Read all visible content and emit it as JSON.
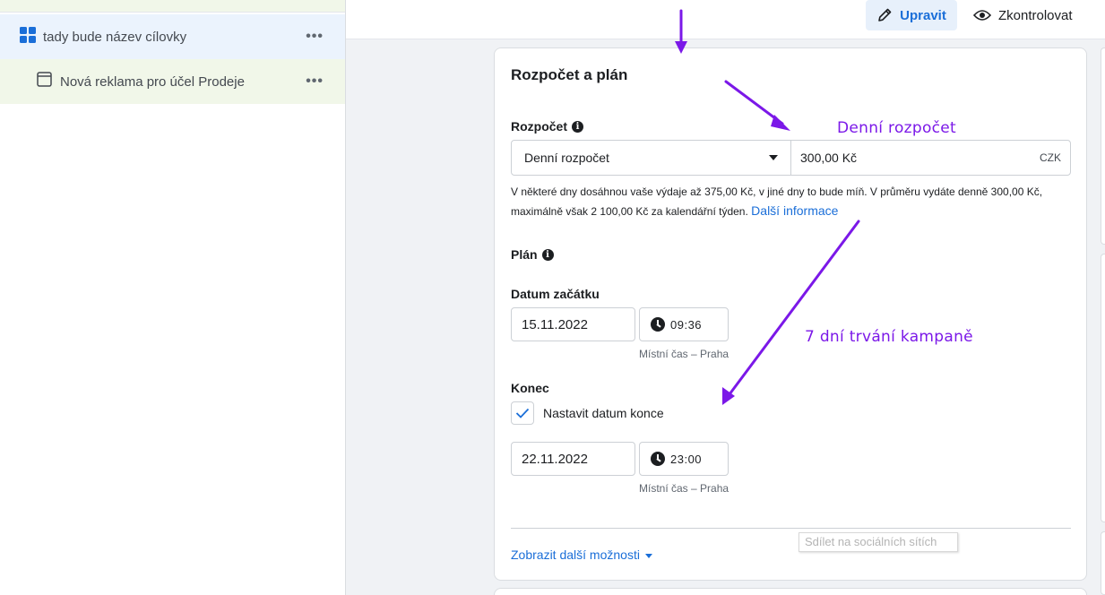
{
  "sidebar": {
    "adset": {
      "label": "tady bude název cílovky",
      "icon": "grid-icon"
    },
    "ad": {
      "label": "Nová reklama pro účel Prodeje",
      "icon": "ad-icon"
    },
    "more_label": "•••"
  },
  "toolbar": {
    "edit_label": "Upravit",
    "review_label": "Zkontrolovat"
  },
  "card": {
    "title": "Rozpočet a plán",
    "budget": {
      "label": "Rozpočet",
      "type_value": "Denní rozpočet",
      "amount_value": "300,00 Kč",
      "currency": "CZK",
      "help_text": "V některé dny dosáhnou vaše výdaje až 375,00 Kč, v jiné dny to bude míň. V průměru vydáte denně 300,00 Kč, maximálně však 2 100,00 Kč za kalendářní týden.",
      "help_link": "Další informace"
    },
    "schedule": {
      "label": "Plán",
      "start_label": "Datum začátku",
      "start_date": "15.11.2022",
      "start_time": "09:36",
      "timezone": "Místní čas – Praha",
      "end_label": "Konec",
      "end_checkbox_label": "Nastavit datum konce",
      "end_checked": true,
      "end_date": "22.11.2022",
      "end_time": "23:00"
    },
    "more_options_label": "Zobrazit další možnosti"
  },
  "tooltip": "Sdílet na sociálních sítích",
  "annotations": {
    "daily_budget": "Denní rozpočet",
    "duration": "7 dní trvání kampaně",
    "color": "#7b18e8"
  },
  "colors": {
    "accent": "#1a6ed8",
    "adset_bg": "#ebf3fd",
    "ad_bg": "#f1f7e9"
  }
}
